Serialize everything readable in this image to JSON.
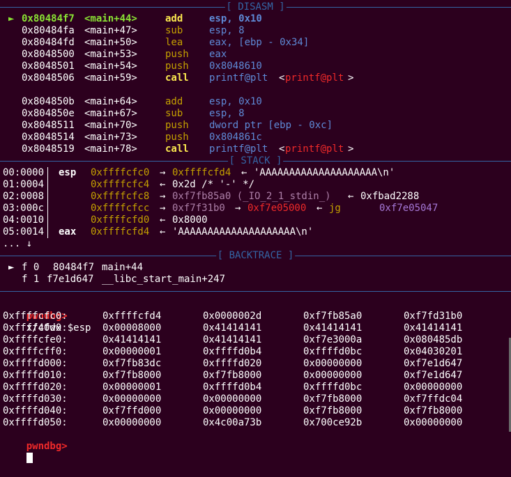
{
  "colors": {
    "background": "#2c001e",
    "separator": "#3465a4",
    "address": "#4e9a06",
    "mnemonic": "#c4a000",
    "operand": "#3465a4",
    "heap_pointer": "#c4a000",
    "libc_pointer": "#ad7fa8",
    "stack_red": "#ef2929",
    "prompt": "#ef2929"
  },
  "disasm": {
    "title": "[ DISASM ]",
    "current_marker": "►",
    "lines": [
      {
        "addr": "0x80484f7",
        "sym": "<main+44>",
        "op": "add",
        "args": "esp, 0x10",
        "current": true
      },
      {
        "addr": "0x80484fa",
        "sym": "<main+47>",
        "op": "sub",
        "args": "esp, 8"
      },
      {
        "addr": "0x80484fd",
        "sym": "<main+50>",
        "op": "lea",
        "args": "eax, [ebp - 0x34]"
      },
      {
        "addr": "0x8048500",
        "sym": "<main+53>",
        "op": "push",
        "args": "eax"
      },
      {
        "addr": "0x8048501",
        "sym": "<main+54>",
        "op": "push",
        "args": "0x8048610"
      },
      {
        "addr": "0x8048506",
        "sym": "<main+59>",
        "op": "call",
        "args": "printf@plt",
        "target": "<printf@plt>"
      },
      {
        "addr": "0x804850b",
        "sym": "<main+64>",
        "op": "add",
        "args": "esp, 0x10"
      },
      {
        "addr": "0x804850e",
        "sym": "<main+67>",
        "op": "sub",
        "args": "esp, 8"
      },
      {
        "addr": "0x8048511",
        "sym": "<main+70>",
        "op": "push",
        "args": "dword ptr [ebp - 0xc]"
      },
      {
        "addr": "0x8048514",
        "sym": "<main+73>",
        "op": "push",
        "args": "0x804861c"
      },
      {
        "addr": "0x8048519",
        "sym": "<main+78>",
        "op": "call",
        "args": "printf@plt",
        "target": "<printf@plt>"
      }
    ]
  },
  "stack": {
    "title": "[ STACK ]",
    "rows": [
      {
        "idx": "00:0000",
        "reg": "esp",
        "addr": "0xffffcfc0",
        "chain": [
          {
            "t": "arrow",
            "v": "→"
          },
          {
            "t": "yellow",
            "v": "0xffffcfd4"
          },
          {
            "t": "arrow",
            "v": "←"
          },
          {
            "t": "white",
            "v": "'AAAAAAAAAAAAAAAAAAAA\\n'"
          }
        ]
      },
      {
        "idx": "01:0004",
        "reg": "",
        "addr": "0xffffcfc4",
        "chain": [
          {
            "t": "arrow",
            "v": "←"
          },
          {
            "t": "white",
            "v": "0x2d /* '-' */"
          }
        ]
      },
      {
        "idx": "02:0008",
        "reg": "",
        "addr": "0xffffcfc8",
        "chain": [
          {
            "t": "arrow",
            "v": "→"
          },
          {
            "t": "magenta",
            "v": "0xf7fb85a0 (_IO_2_1_stdin_)"
          },
          {
            "t": "arrow",
            "v": "←"
          },
          {
            "t": "white",
            "v": "0xfbad2288"
          }
        ]
      },
      {
        "idx": "03:000c",
        "reg": "",
        "addr": "0xffffcfcc",
        "chain": [
          {
            "t": "arrow",
            "v": "→"
          },
          {
            "t": "magenta",
            "v": "0xf7f31b0"
          },
          {
            "t": "arrow",
            "v": "→"
          },
          {
            "t": "red",
            "v": "0xf7e05000"
          },
          {
            "t": "arrow",
            "v": "←"
          },
          {
            "t": "yellow",
            "v": "jg"
          },
          {
            "t": "purple",
            "v": "0xf7e05047"
          }
        ]
      },
      {
        "idx": "04:0010",
        "reg": "",
        "addr": "0xffffcfd0",
        "chain": [
          {
            "t": "arrow",
            "v": "←"
          },
          {
            "t": "white",
            "v": "0x8000"
          }
        ]
      },
      {
        "idx": "05:0014",
        "reg": "eax",
        "addr": "0xffffcfd4",
        "chain": [
          {
            "t": "arrow",
            "v": "←"
          },
          {
            "t": "white",
            "v": "'AAAAAAAAAAAAAAAAAAAA\\n'"
          }
        ]
      }
    ],
    "more": "... ↓"
  },
  "backtrace": {
    "title": "[ BACKTRACE ]",
    "frames": [
      {
        "marker": "►",
        "label": "f 0",
        "addr": "80484f7",
        "sym": "main+44"
      },
      {
        "marker": "",
        "label": "f 1",
        "addr": "f7e1d647",
        "sym": "__libc_start_main+247"
      }
    ]
  },
  "command": {
    "prompt": "pwndbg>",
    "text": "x/40wx $esp"
  },
  "memdump": [
    {
      "addr": "0xffffcfc0:",
      "words": [
        "0xffffcfd4",
        "0x0000002d",
        "0xf7fb85a0",
        "0xf7fd31b0"
      ]
    },
    {
      "addr": "0xffffcfd0:",
      "words": [
        "0x00008000",
        "0x41414141",
        "0x41414141",
        "0x41414141"
      ]
    },
    {
      "addr": "0xffffcfe0:",
      "words": [
        "0x41414141",
        "0x41414141",
        "0xf7e3000a",
        "0x080485db"
      ]
    },
    {
      "addr": "0xffffcff0:",
      "words": [
        "0x00000001",
        "0xffffd0b4",
        "0xffffd0bc",
        "0x04030201"
      ]
    },
    {
      "addr": "0xffffd000:",
      "words": [
        "0xf7fb83dc",
        "0xffffd020",
        "0x00000000",
        "0xf7e1d647"
      ]
    },
    {
      "addr": "0xffffd010:",
      "words": [
        "0xf7fb8000",
        "0xf7fb8000",
        "0x00000000",
        "0xf7e1d647"
      ]
    },
    {
      "addr": "0xffffd020:",
      "words": [
        "0x00000001",
        "0xffffd0b4",
        "0xffffd0bc",
        "0x00000000"
      ]
    },
    {
      "addr": "0xffffd030:",
      "words": [
        "0x00000000",
        "0x00000000",
        "0xf7fb8000",
        "0xf7ffdc04"
      ]
    },
    {
      "addr": "0xffffd040:",
      "words": [
        "0xf7ffd000",
        "0x00000000",
        "0xf7fb8000",
        "0xf7fb8000"
      ]
    },
    {
      "addr": "0xffffd050:",
      "words": [
        "0x00000000",
        "0x4c00a73b",
        "0x700ce92b",
        "0x00000000"
      ]
    }
  ],
  "last_prompt": "pwndbg>"
}
